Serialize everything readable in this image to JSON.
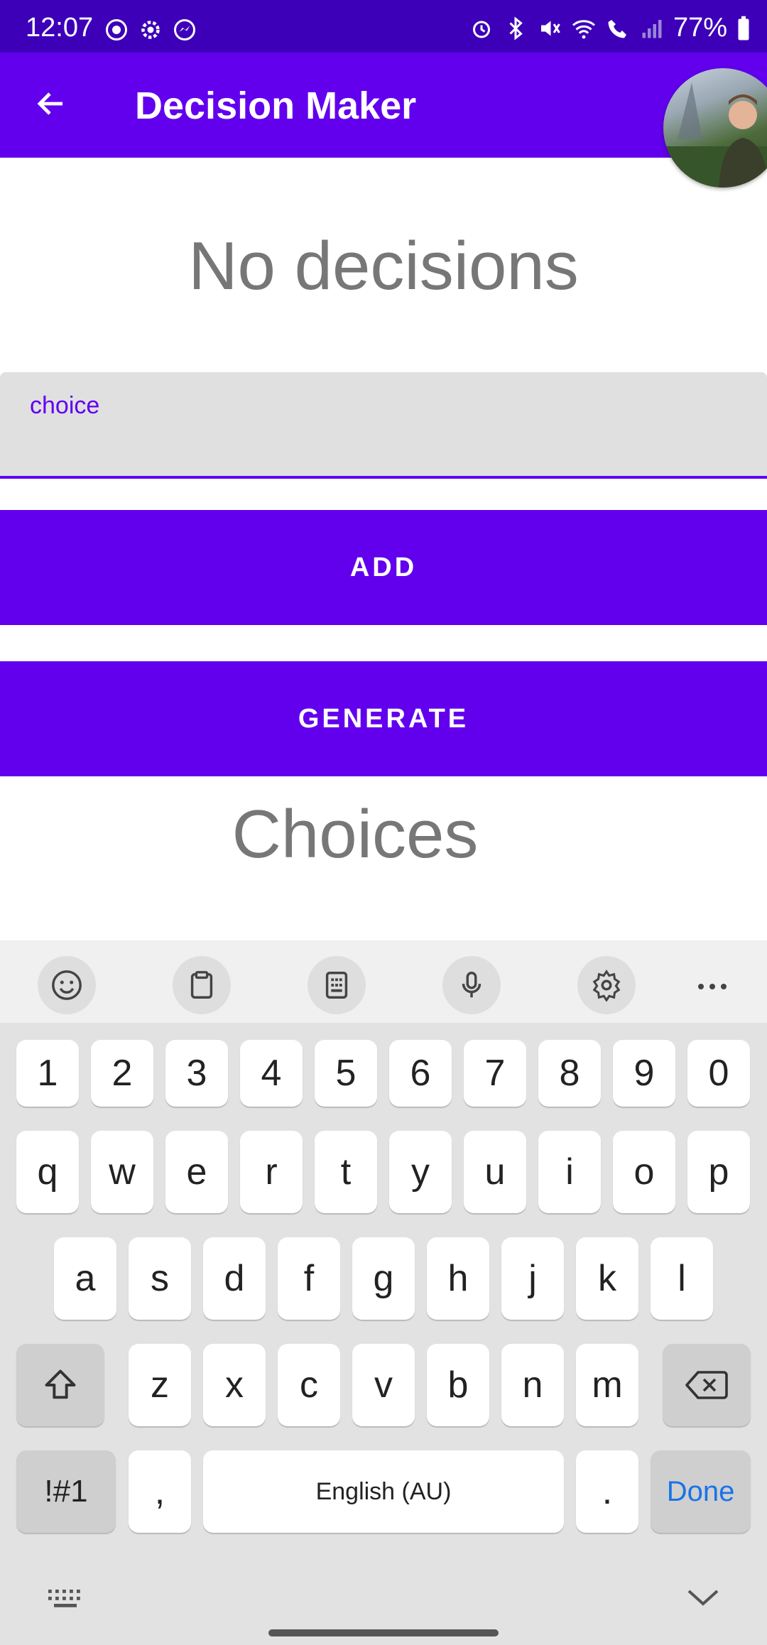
{
  "status_bar": {
    "time": "12:07",
    "battery": "77%"
  },
  "app_bar": {
    "title": "Decision Maker"
  },
  "main": {
    "empty_heading": "No decisions",
    "field_label": "choice",
    "field_value": "",
    "add_label": "ADD",
    "generate_label": "GENERATE",
    "choices_heading": "Choices"
  },
  "keyboard": {
    "row_numbers": [
      "1",
      "2",
      "3",
      "4",
      "5",
      "6",
      "7",
      "8",
      "9",
      "0"
    ],
    "row_1": [
      "q",
      "w",
      "e",
      "r",
      "t",
      "y",
      "u",
      "i",
      "o",
      "p"
    ],
    "row_2": [
      "a",
      "s",
      "d",
      "f",
      "g",
      "h",
      "j",
      "k",
      "l"
    ],
    "row_3": [
      "z",
      "x",
      "c",
      "v",
      "b",
      "n",
      "m"
    ],
    "symbols": "!#1",
    "comma": ",",
    "space": "English (AU)",
    "period": ".",
    "done": "Done"
  },
  "colors": {
    "status_bar": "#3d00b8",
    "primary": "#6200ee",
    "heading_gray": "#777777",
    "done_blue": "#1a73e8"
  }
}
